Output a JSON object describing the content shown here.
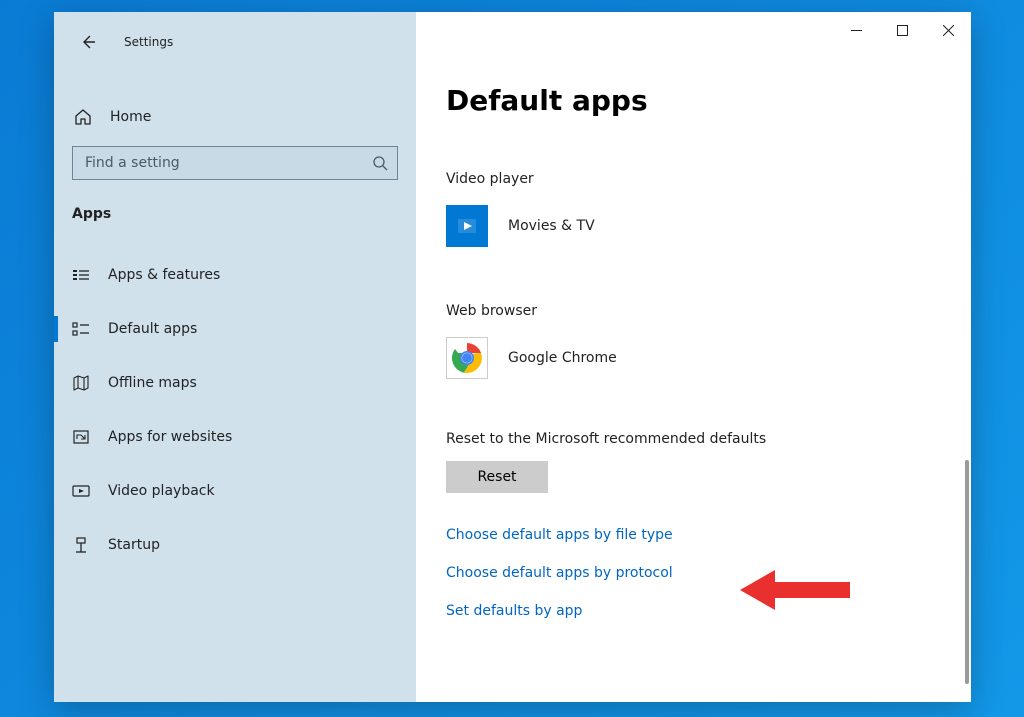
{
  "app_title": "Settings",
  "home_label": "Home",
  "search_placeholder": "Find a setting",
  "section_header": "Apps",
  "nav": [
    {
      "label": "Apps & features",
      "icon": "apps-features-icon",
      "active": false
    },
    {
      "label": "Default apps",
      "icon": "default-apps-icon",
      "active": true
    },
    {
      "label": "Offline maps",
      "icon": "offline-maps-icon",
      "active": false
    },
    {
      "label": "Apps for websites",
      "icon": "apps-websites-icon",
      "active": false
    },
    {
      "label": "Video playback",
      "icon": "video-playback-icon",
      "active": false
    },
    {
      "label": "Startup",
      "icon": "startup-icon",
      "active": false
    }
  ],
  "page_title": "Default apps",
  "groups": {
    "video": {
      "label": "Video player",
      "app": "Movies & TV"
    },
    "browser": {
      "label": "Web browser",
      "app": "Google Chrome"
    }
  },
  "reset": {
    "label": "Reset to the Microsoft recommended defaults",
    "button": "Reset"
  },
  "links": {
    "by_file_type": "Choose default apps by file type",
    "by_protocol": "Choose default apps by protocol",
    "by_app": "Set defaults by app"
  },
  "annotation": {
    "arrow_color": "#ea2f2f",
    "target": "by_protocol"
  }
}
